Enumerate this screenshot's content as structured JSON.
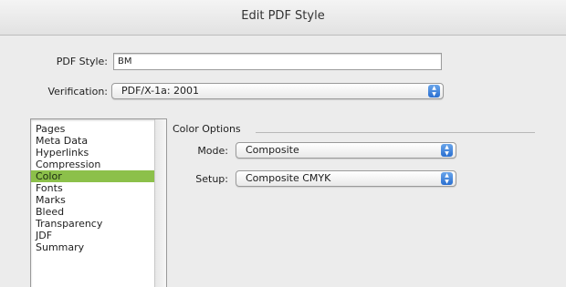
{
  "window": {
    "title": "Edit PDF Style"
  },
  "form": {
    "pdf_style_label": "PDF Style:",
    "pdf_style_value": "BM",
    "verification_label": "Verification:",
    "verification_value": "PDF/X-1a: 2001"
  },
  "sidebar": {
    "items": [
      {
        "label": "Pages"
      },
      {
        "label": "Meta Data"
      },
      {
        "label": "Hyperlinks"
      },
      {
        "label": "Compression"
      },
      {
        "label": "Color",
        "selected": true
      },
      {
        "label": "Fonts"
      },
      {
        "label": "Marks"
      },
      {
        "label": "Bleed"
      },
      {
        "label": "Transparency"
      },
      {
        "label": "JDF"
      },
      {
        "label": "Summary"
      }
    ]
  },
  "color_options": {
    "title": "Color Options",
    "mode_label": "Mode:",
    "mode_value": "Composite",
    "setup_label": "Setup:",
    "setup_value": "Composite CMYK"
  },
  "colors": {
    "selection": "#8cc04a",
    "popup_arrows": "#2a6fd0"
  },
  "icons": {
    "popup_arrows": "up-down-arrows-icon"
  }
}
